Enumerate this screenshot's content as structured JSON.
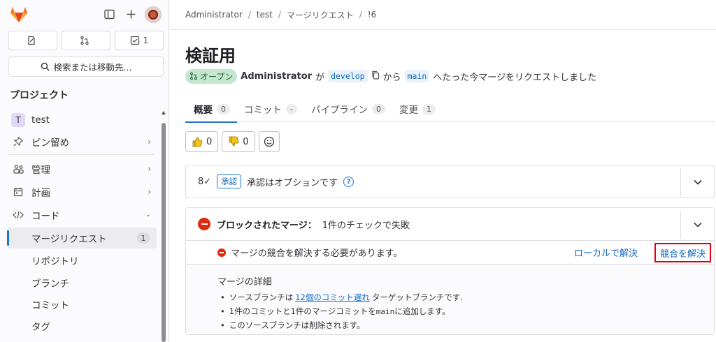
{
  "sidebar": {
    "counters": [
      {
        "icon": "issues-icon",
        "label": ""
      },
      {
        "icon": "merge-request-icon",
        "label": ""
      },
      {
        "icon": "todo-icon",
        "label": "1"
      }
    ],
    "search_label": "検索または移動先...",
    "section_title": "プロジェクト",
    "project": {
      "avatar_letter": "T",
      "name": "test"
    },
    "items": [
      {
        "label": "ピン留め"
      },
      {
        "label": "管理"
      },
      {
        "label": "計画"
      },
      {
        "label": "コード"
      }
    ],
    "code_subitems": [
      {
        "label": "マージリクエスト",
        "badge": "1"
      },
      {
        "label": "リポジトリ"
      },
      {
        "label": "ブランチ"
      },
      {
        "label": "コミット"
      },
      {
        "label": "タグ"
      }
    ]
  },
  "breadcrumb": [
    "Administrator",
    "test",
    "マージリクエスト",
    "!6"
  ],
  "mr": {
    "title": "検証用",
    "status": "オープン",
    "author": "Administrator",
    "particle_ga": "が",
    "source_branch": "develop",
    "particle_kara": "から",
    "target_branch": "main",
    "suffix": "へたった今マージをリクエストしました"
  },
  "tabs": [
    {
      "label": "概要",
      "count": "0"
    },
    {
      "label": "コミット",
      "count": "-"
    },
    {
      "label": "パイプライン",
      "count": "0"
    },
    {
      "label": "変更",
      "count": "1"
    }
  ],
  "reactions": {
    "thumbs_up": "0",
    "thumbs_down": "0"
  },
  "approval": {
    "icon_text": "8✓",
    "chip": "承認",
    "text": "承認はオプションです",
    "help": "?"
  },
  "blocked": {
    "title": "ブロックされたマージ：",
    "subtitle": "1件のチェックで失敗",
    "conflict_text": "マージの競合を解決する必要があります。",
    "local_link": "ローカルで解決",
    "resolve_button": "競合を解決",
    "details_title": "マージの詳細",
    "detail1_pre": "ソースブランチは",
    "detail1_link": "12個のコミット遅れ",
    "detail1_post": "ターゲットブランチです.",
    "detail2_pre": "1件のコミットと1件のマージコミットを",
    "detail2_code": "main",
    "detail2_post": "に追加します。",
    "detail3": "このソースブランチは削除されます。"
  },
  "colors": {
    "accent": "#1f75cb",
    "danger": "#dd2b0e",
    "success_bg": "#c3e6cd",
    "highlight_border": "#e3000f"
  }
}
